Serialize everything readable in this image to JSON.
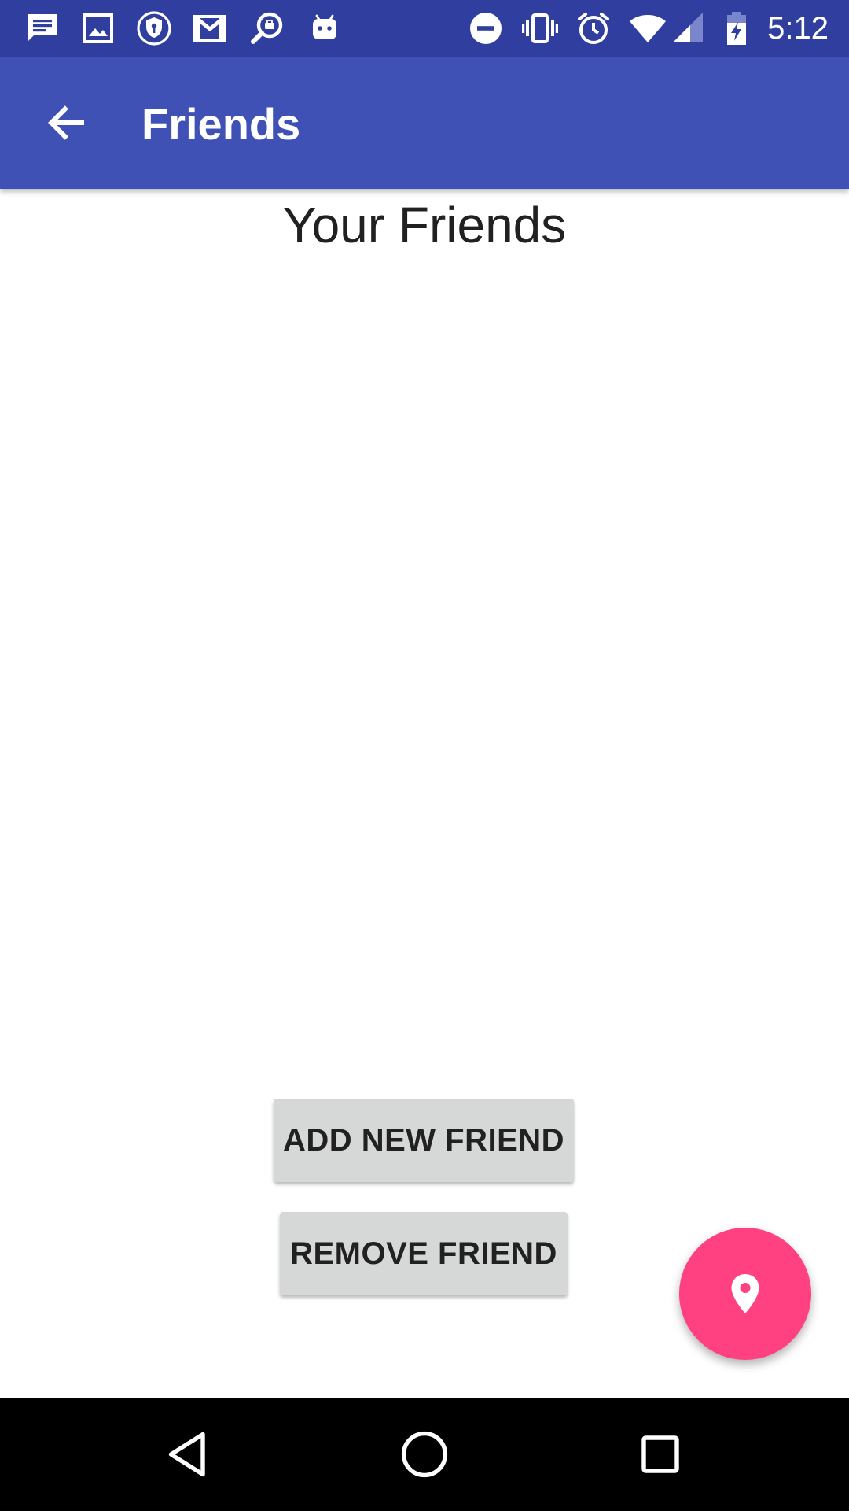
{
  "status_bar": {
    "time": "5:12",
    "notification_icons": [
      "message-icon",
      "image-icon",
      "vpn-shield-icon",
      "gmail-icon",
      "search-work-icon",
      "android-icon"
    ],
    "system_icons": [
      "do-not-disturb-icon",
      "vibrate-icon",
      "alarm-icon",
      "wifi-icon",
      "cell-signal-icon",
      "battery-charging-icon"
    ],
    "background_color": "#303f9f"
  },
  "app_bar": {
    "title": "Friends",
    "back_icon": "arrow-back-icon",
    "background_color": "#3f51b5"
  },
  "main": {
    "heading": "Your Friends",
    "add_button_label": "ADD NEW FRIEND",
    "remove_button_label": "REMOVE FRIEND"
  },
  "fab": {
    "icon": "location-pin-icon",
    "color": "#ff4081"
  },
  "nav_bar": {
    "buttons": [
      "back-triangle-icon",
      "home-circle-icon",
      "recents-square-icon"
    ]
  }
}
